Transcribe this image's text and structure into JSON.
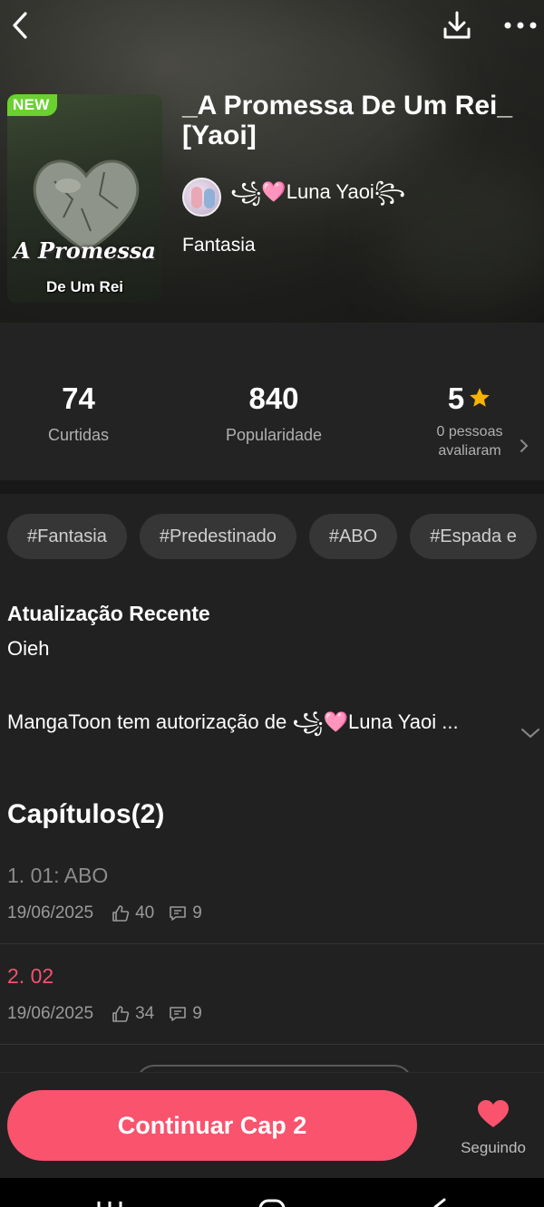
{
  "header": {
    "badge": "NEW",
    "title": "_A Promessa De Um Rei_ [Yaoi]",
    "cover_title_line1": "A Promessa",
    "cover_title_line2": "De Um Rei",
    "author": "꧁🩷Luna Yaoi꧂",
    "genre": "Fantasia"
  },
  "stats": {
    "likes": {
      "value": "74",
      "label": "Curtidas"
    },
    "popularity": {
      "value": "840",
      "label": "Popularidade"
    },
    "rating": {
      "value": "5",
      "label": "0 pessoas avaliaram"
    }
  },
  "tags": [
    "#Fantasia",
    "#Predestinado",
    "#ABO",
    "#Espada e"
  ],
  "recent": {
    "heading": "Atualização Recente",
    "text": "Oieh",
    "authorization": "MangaToon tem autorização de ꧁🩷Luna Yaoi ..."
  },
  "chapters": {
    "heading": "Capítulos(2)",
    "items": [
      {
        "title": "1. 01: ABO",
        "date": "19/06/2025",
        "likes": "40",
        "comments": "9"
      },
      {
        "title": "2. 02",
        "date": "19/06/2025",
        "likes": "34",
        "comments": "9"
      }
    ]
  },
  "bottom": {
    "continue_label": "Continuar Cap 2",
    "follow_label": "Seguindo"
  },
  "colors": {
    "accent": "#f9536e",
    "badge_green": "#6ad12f",
    "star": "#f5b400",
    "background": "#212121"
  },
  "icons": [
    "back-arrow-icon",
    "download-icon",
    "more-icon",
    "star-icon",
    "chevron-right-icon",
    "chevron-down-icon",
    "thumb-up-icon",
    "comment-icon",
    "heart-icon"
  ]
}
